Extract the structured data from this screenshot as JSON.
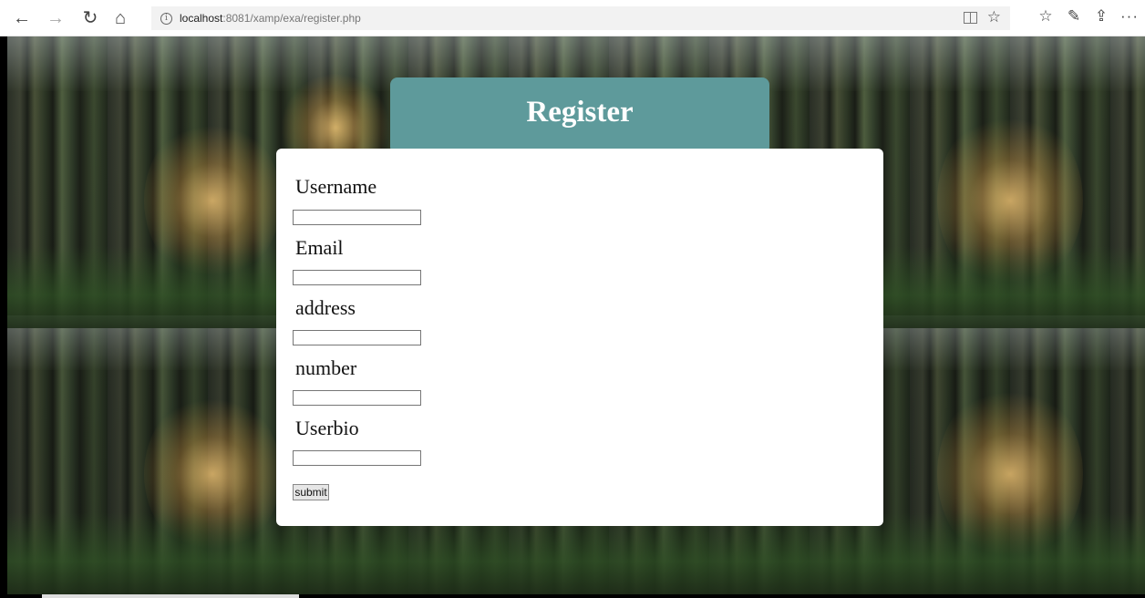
{
  "browser": {
    "url_host": "localhost",
    "url_rest": ":8081/xamp/exa/register.php",
    "icons": {
      "back": "back-arrow-icon",
      "forward": "forward-arrow-icon",
      "refresh": "refresh-icon",
      "home": "home-icon",
      "info": "info-icon",
      "reading_view": "reading-view-icon",
      "favorite": "star-icon",
      "favorites": "favorites-list-icon",
      "ink": "pen-icon",
      "share": "share-icon",
      "more": "more-icon"
    }
  },
  "form": {
    "title": "Register",
    "header_color": "#5e9a9b",
    "fields": [
      {
        "label": "Username",
        "value": ""
      },
      {
        "label": "Email",
        "value": ""
      },
      {
        "label": "address",
        "value": ""
      },
      {
        "label": "number",
        "value": ""
      },
      {
        "label": "Userbio",
        "value": ""
      }
    ],
    "submit_label": "submit"
  }
}
